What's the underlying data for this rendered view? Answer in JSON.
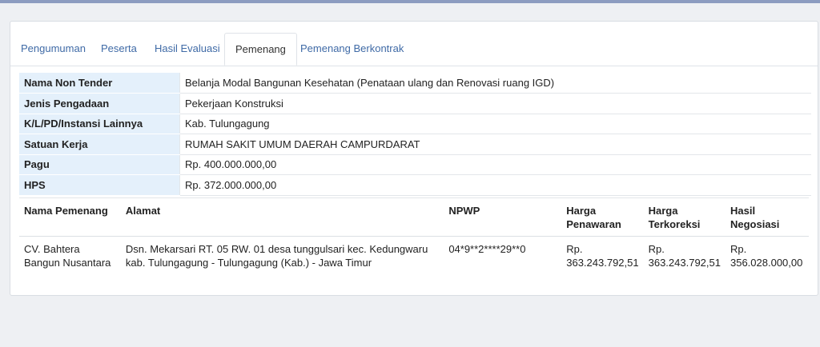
{
  "tabs": [
    {
      "label": "Pengumuman"
    },
    {
      "label": "Peserta"
    },
    {
      "label": "Hasil Evaluasi"
    },
    {
      "label": "Pemenang"
    },
    {
      "label": "Pemenang Berkontrak"
    }
  ],
  "active_tab": "Pemenang",
  "info": [
    {
      "label": "Nama Non Tender",
      "value": "Belanja Modal Bangunan Kesehatan (Penataan ulang dan Renovasi ruang IGD)"
    },
    {
      "label": "Jenis Pengadaan",
      "value": "Pekerjaan Konstruksi"
    },
    {
      "label": "K/L/PD/Instansi Lainnya",
      "value": "Kab. Tulungagung"
    },
    {
      "label": "Satuan Kerja",
      "value": "RUMAH SAKIT UMUM DAERAH CAMPURDARAT"
    },
    {
      "label": "Pagu",
      "value": "Rp. 400.000.000,00"
    },
    {
      "label": "HPS",
      "value": "Rp. 372.000.000,00"
    }
  ],
  "winners": {
    "headers": {
      "nama": "Nama Pemenang",
      "alamat": "Alamat",
      "npwp": "NPWP",
      "harga_penawaran": "Harga Penawaran",
      "harga_terkoreksi": "Harga Terkoreksi",
      "hasil_negosiasi": "Hasil Negosiasi"
    },
    "rows": [
      {
        "nama": "CV. Bahtera Bangun Nusantara",
        "alamat": "Dsn. Mekarsari RT. 05 RW. 01 desa tunggulsari kec. Kedungwaru kab. Tulungagung - Tulungagung (Kab.) - Jawa Timur",
        "npwp": "04*9**2****29**0",
        "harga_penawaran": "Rp. 363.243.792,51",
        "harga_terkoreksi": "Rp. 363.243.792,51",
        "hasil_negosiasi": "Rp. 356.028.000,00"
      }
    ]
  }
}
